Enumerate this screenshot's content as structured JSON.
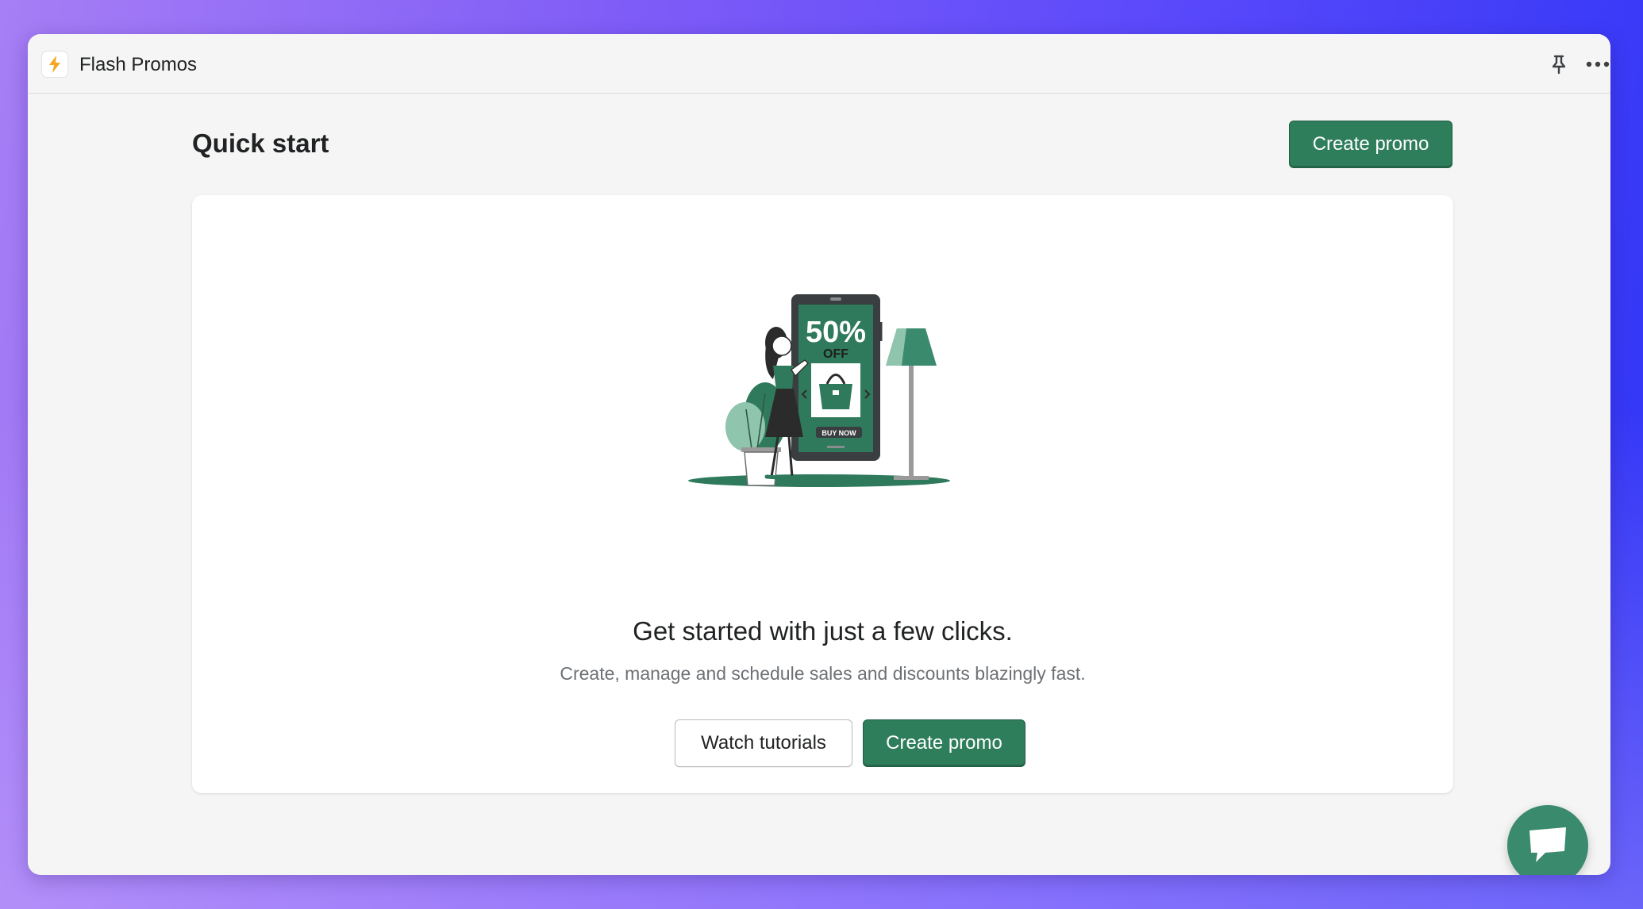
{
  "app": {
    "title": "Flash Promos",
    "icon": "lightning-bolt-icon"
  },
  "titlebar": {
    "pin_icon": "pin-icon",
    "more_icon": "more-horizontal-icon"
  },
  "page": {
    "title": "Quick start",
    "primary_action_label": "Create promo"
  },
  "empty_state": {
    "illustration": {
      "discount_text": "50%",
      "off_text": "OFF",
      "cta_text": "BUY NOW"
    },
    "heading": "Get started with just a few clicks.",
    "description": "Create, manage and schedule sales and discounts blazingly fast.",
    "secondary_action_label": "Watch tutorials",
    "primary_action_label": "Create promo"
  },
  "chat": {
    "icon": "chat-bubble-icon"
  },
  "colors": {
    "primary": "#2e7d5b",
    "accent_green": "#2f7a5c",
    "chat": "#3a8a6e",
    "bolt": "#f5a623"
  }
}
